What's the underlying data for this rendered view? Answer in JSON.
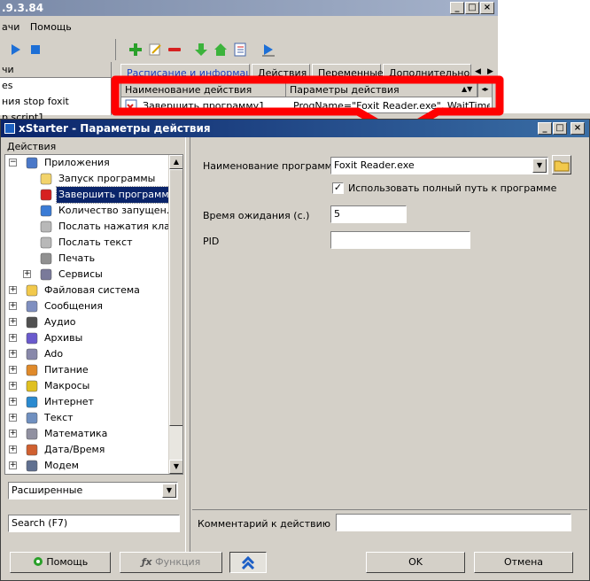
{
  "bg_window": {
    "title_fragment": ".9.3.84",
    "menu": [
      "ачи",
      "Помощь"
    ],
    "left_list_header": "чи",
    "left_list_items": [
      "es",
      "ния stop foxit",
      "p script1"
    ],
    "tabs": [
      "Расписание и информация",
      "Действия",
      "Переменные",
      "Дополнительно"
    ],
    "table_headers": [
      "Наименование действия",
      "Параметры действия"
    ],
    "table_row": {
      "name": "Завершить программу1",
      "params": "ProgName=\"Foxit Reader.exe\", WaitTime=..."
    }
  },
  "dialog": {
    "title": "xStarter - Параметры действия",
    "left_panel_header": "Действия",
    "tree": [
      {
        "label": "Приложения",
        "icon": "computer-icon",
        "level": 0,
        "expanded": true
      },
      {
        "label": "Запуск программы",
        "icon": "document-icon",
        "level": 1
      },
      {
        "label": "Завершить программу",
        "icon": "window-close-icon",
        "level": 1,
        "selected": true
      },
      {
        "label": "Количество запущен...",
        "icon": "grid-icon",
        "level": 1
      },
      {
        "label": "Послать нажатия кла...",
        "icon": "cube-icon",
        "level": 1
      },
      {
        "label": "Послать текст",
        "icon": "cube-icon",
        "level": 1
      },
      {
        "label": "Печать",
        "icon": "printer-icon",
        "level": 1
      },
      {
        "label": "Сервисы",
        "icon": "gears-icon",
        "level": 1,
        "expandable": true
      },
      {
        "label": "Файловая система",
        "icon": "folder-icon",
        "level": 0,
        "expandable": true
      },
      {
        "label": "Сообщения",
        "icon": "messages-icon",
        "level": 0,
        "expandable": true
      },
      {
        "label": "Аудио",
        "icon": "speaker-icon",
        "level": 0,
        "expandable": true
      },
      {
        "label": "Архивы",
        "icon": "archive-icon",
        "level": 0,
        "expandable": true
      },
      {
        "label": "Ado",
        "icon": "database-icon",
        "level": 0,
        "expandable": true
      },
      {
        "label": "Питание",
        "icon": "power-icon",
        "level": 0,
        "expandable": true
      },
      {
        "label": "Макросы",
        "icon": "macro-icon",
        "level": 0,
        "expandable": true
      },
      {
        "label": "Интернет",
        "icon": "globe-icon",
        "level": 0,
        "expandable": true
      },
      {
        "label": "Текст",
        "icon": "text-icon",
        "level": 0,
        "expandable": true
      },
      {
        "label": "Математика",
        "icon": "calculator-icon",
        "level": 0,
        "expandable": true
      },
      {
        "label": "Дата/Время",
        "icon": "calendar-icon",
        "level": 0,
        "expandable": true
      },
      {
        "label": "Модем",
        "icon": "modem-icon",
        "level": 0,
        "expandable": true
      }
    ],
    "filter_combo": "Расширенные",
    "search_placeholder": "Search (F7)",
    "form": {
      "program_name_label": "Наименование программы",
      "program_name_value": "Foxit Reader.exe",
      "full_path_label": "Использовать полный путь к программе",
      "full_path_checked": true,
      "wait_label": "Время ожидания (с.)",
      "wait_value": "5",
      "pid_label": "PID",
      "pid_value": ""
    },
    "comment_label": "Комментарий к действию",
    "comment_value": "",
    "buttons": {
      "help": "Помощь",
      "function": "Функция",
      "ok": "OK",
      "cancel": "Отмена"
    }
  },
  "colors": {
    "highlight": "#ff0000",
    "title_active": "#0a246a",
    "selection": "#0a246a"
  }
}
